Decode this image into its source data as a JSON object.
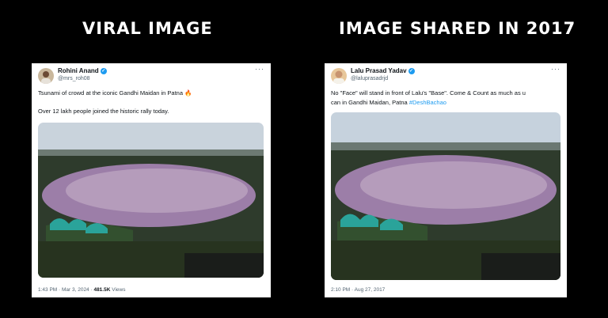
{
  "headings": {
    "left": "VIRAL IMAGE",
    "right": "IMAGE SHARED IN 2017"
  },
  "colors": {
    "background": "#000000",
    "verified": "#1d9bf0",
    "hashtag": "#1d9bf0",
    "crowd": "#9c7ea8",
    "tents": "#2aa39a"
  },
  "left_post": {
    "name": "Rohini Anand",
    "handle": "@mrs_roh08",
    "more": "···",
    "line1": "Tsunami of crowd at the iconic Gandhi Maidan in Patna",
    "emoji": "🔥",
    "line2": "Over 12 lakh people joined the historic rally today.",
    "time": "1:43 PM · Mar 3, 2024 · ",
    "views_count": "481.5K",
    "views_label": " Views"
  },
  "right_post": {
    "name": "Lalu Prasad Yadav",
    "handle": "@laluprasadrjd",
    "more": "···",
    "text_line1": "No \"Face\" will stand in front of Lalu's \"Base\". Come & Count as much as u",
    "text_line2": "can in Gandhi Maidan, Patna ",
    "hashtag": "#DeshBachao",
    "time": "2:10 PM · Aug 27, 2017"
  }
}
